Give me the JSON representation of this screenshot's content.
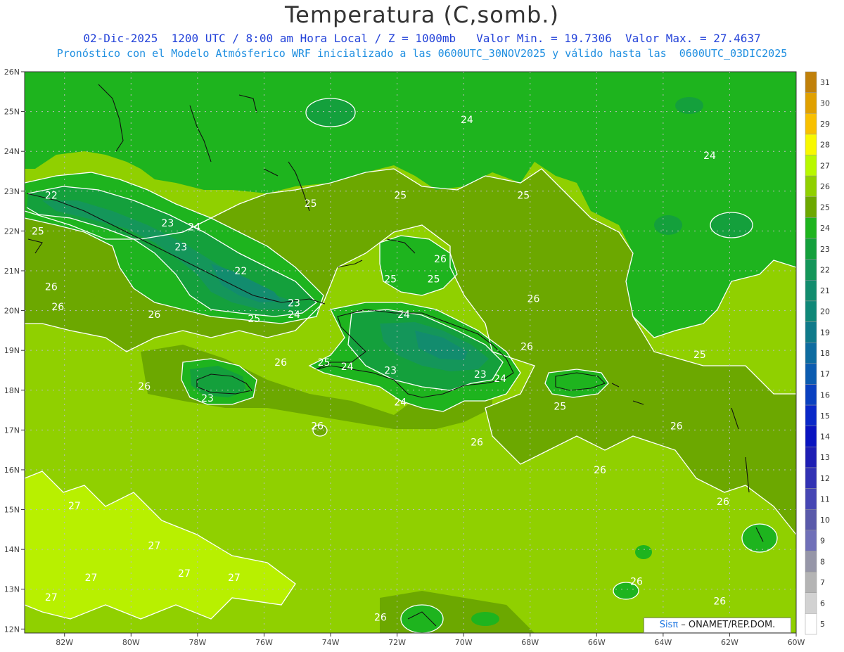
{
  "header": {
    "title": "Temperatura (C,somb.)",
    "line1": "02-Dic-2025  1200 UTC / 8:00 am Hora Local / Z = 1000mb   Valor Min. = 19.7306  Valor Max. = 27.4637",
    "line2": "Pronóstico con el Modelo Atmósferico WRF inicializado a las 0600UTC_30NOV2025 y válido hasta las  0600UTC_03DIC2025"
  },
  "map": {
    "lat_ticks": [
      "26N",
      "25N",
      "24N",
      "23N",
      "22N",
      "21N",
      "20N",
      "19N",
      "18N",
      "17N",
      "16N",
      "15N",
      "14N",
      "13N",
      "12N"
    ],
    "lon_ticks": [
      "82W",
      "80W",
      "78W",
      "76W",
      "74W",
      "72W",
      "70W",
      "68W",
      "66W",
      "64W",
      "62W",
      "60W"
    ],
    "contour_labels": [
      {
        "text": "24",
        "lon": -69.9,
        "lat": 24.8
      },
      {
        "text": "24",
        "lon": -62.6,
        "lat": 23.9
      },
      {
        "text": "25",
        "lon": -74.6,
        "lat": 22.7
      },
      {
        "text": "25",
        "lon": -71.9,
        "lat": 22.9
      },
      {
        "text": "25",
        "lon": -68.2,
        "lat": 22.9
      },
      {
        "text": "22",
        "lon": -82.4,
        "lat": 22.9
      },
      {
        "text": "25",
        "lon": -82.8,
        "lat": 22.0
      },
      {
        "text": "23",
        "lon": -78.9,
        "lat": 22.2
      },
      {
        "text": "24",
        "lon": -78.1,
        "lat": 22.1
      },
      {
        "text": "23",
        "lon": -78.5,
        "lat": 21.6
      },
      {
        "text": "22",
        "lon": -76.7,
        "lat": 21.0
      },
      {
        "text": "26",
        "lon": -70.7,
        "lat": 21.3
      },
      {
        "text": "25",
        "lon": -72.2,
        "lat": 20.8
      },
      {
        "text": "25",
        "lon": -70.9,
        "lat": 20.8
      },
      {
        "text": "26",
        "lon": -82.4,
        "lat": 20.6
      },
      {
        "text": "26",
        "lon": -82.2,
        "lat": 20.1
      },
      {
        "text": "26",
        "lon": -79.3,
        "lat": 19.9
      },
      {
        "text": "23",
        "lon": -75.1,
        "lat": 20.2
      },
      {
        "text": "24",
        "lon": -75.1,
        "lat": 19.9
      },
      {
        "text": "25",
        "lon": -76.3,
        "lat": 19.8
      },
      {
        "text": "24",
        "lon": -71.8,
        "lat": 19.9
      },
      {
        "text": "26",
        "lon": -67.9,
        "lat": 20.3
      },
      {
        "text": "26",
        "lon": -68.1,
        "lat": 19.1
      },
      {
        "text": "25",
        "lon": -62.9,
        "lat": 18.9
      },
      {
        "text": "26",
        "lon": -75.5,
        "lat": 18.7
      },
      {
        "text": "25",
        "lon": -74.2,
        "lat": 18.7
      },
      {
        "text": "24",
        "lon": -73.5,
        "lat": 18.6
      },
      {
        "text": "23",
        "lon": -72.2,
        "lat": 18.5
      },
      {
        "text": "23",
        "lon": -69.5,
        "lat": 18.4
      },
      {
        "text": "24",
        "lon": -68.9,
        "lat": 18.3
      },
      {
        "text": "26",
        "lon": -79.6,
        "lat": 18.1
      },
      {
        "text": "23",
        "lon": -77.7,
        "lat": 17.8
      },
      {
        "text": "24",
        "lon": -71.9,
        "lat": 17.7
      },
      {
        "text": "25",
        "lon": -67.1,
        "lat": 17.6
      },
      {
        "text": "26",
        "lon": -74.4,
        "lat": 17.1
      },
      {
        "text": "26",
        "lon": -63.6,
        "lat": 17.1
      },
      {
        "text": "26",
        "lon": -69.6,
        "lat": 16.7
      },
      {
        "text": "26",
        "lon": -65.9,
        "lat": 16.0
      },
      {
        "text": "27",
        "lon": -81.7,
        "lat": 15.1
      },
      {
        "text": "26",
        "lon": -62.2,
        "lat": 15.2
      },
      {
        "text": "27",
        "lon": -79.3,
        "lat": 14.1
      },
      {
        "text": "27",
        "lon": -81.2,
        "lat": 13.3
      },
      {
        "text": "27",
        "lon": -78.4,
        "lat": 13.4
      },
      {
        "text": "27",
        "lon": -76.9,
        "lat": 13.3
      },
      {
        "text": "26",
        "lon": -64.8,
        "lat": 13.2
      },
      {
        "text": "27",
        "lon": -82.4,
        "lat": 12.8
      },
      {
        "text": "26",
        "lon": -62.3,
        "lat": 12.7
      },
      {
        "text": "26",
        "lon": -72.5,
        "lat": 12.3
      }
    ]
  },
  "colorbar": {
    "labels": [
      "31",
      "30",
      "29",
      "28",
      "27",
      "26",
      "25",
      "24",
      "23",
      "22",
      "21",
      "20",
      "19",
      "18",
      "17",
      "16",
      "15",
      "14",
      "13",
      "12",
      "11",
      "10",
      "9",
      "8",
      "7",
      "6",
      "5"
    ],
    "colors": [
      "#c0800a",
      "#e0a000",
      "#f8c000",
      "#f8f800",
      "#b8f800",
      "#90d000",
      "#6ca800",
      "#1eb41e",
      "#14a03c",
      "#14965a",
      "#128c6e",
      "#0f8878",
      "#0f7a8a",
      "#0e6ca0",
      "#0c5cb0",
      "#0a40c0",
      "#0a28c8",
      "#0a14c0",
      "#1e1eb4",
      "#3232b4",
      "#4646b4",
      "#5a5aaa",
      "#7070b8",
      "#9696a8",
      "#b4b4b4",
      "#d2d2d2",
      "#ffffff"
    ]
  },
  "credit": {
    "brand": "Sisπ",
    "text": " – ONAMET/REP.DOM."
  }
}
